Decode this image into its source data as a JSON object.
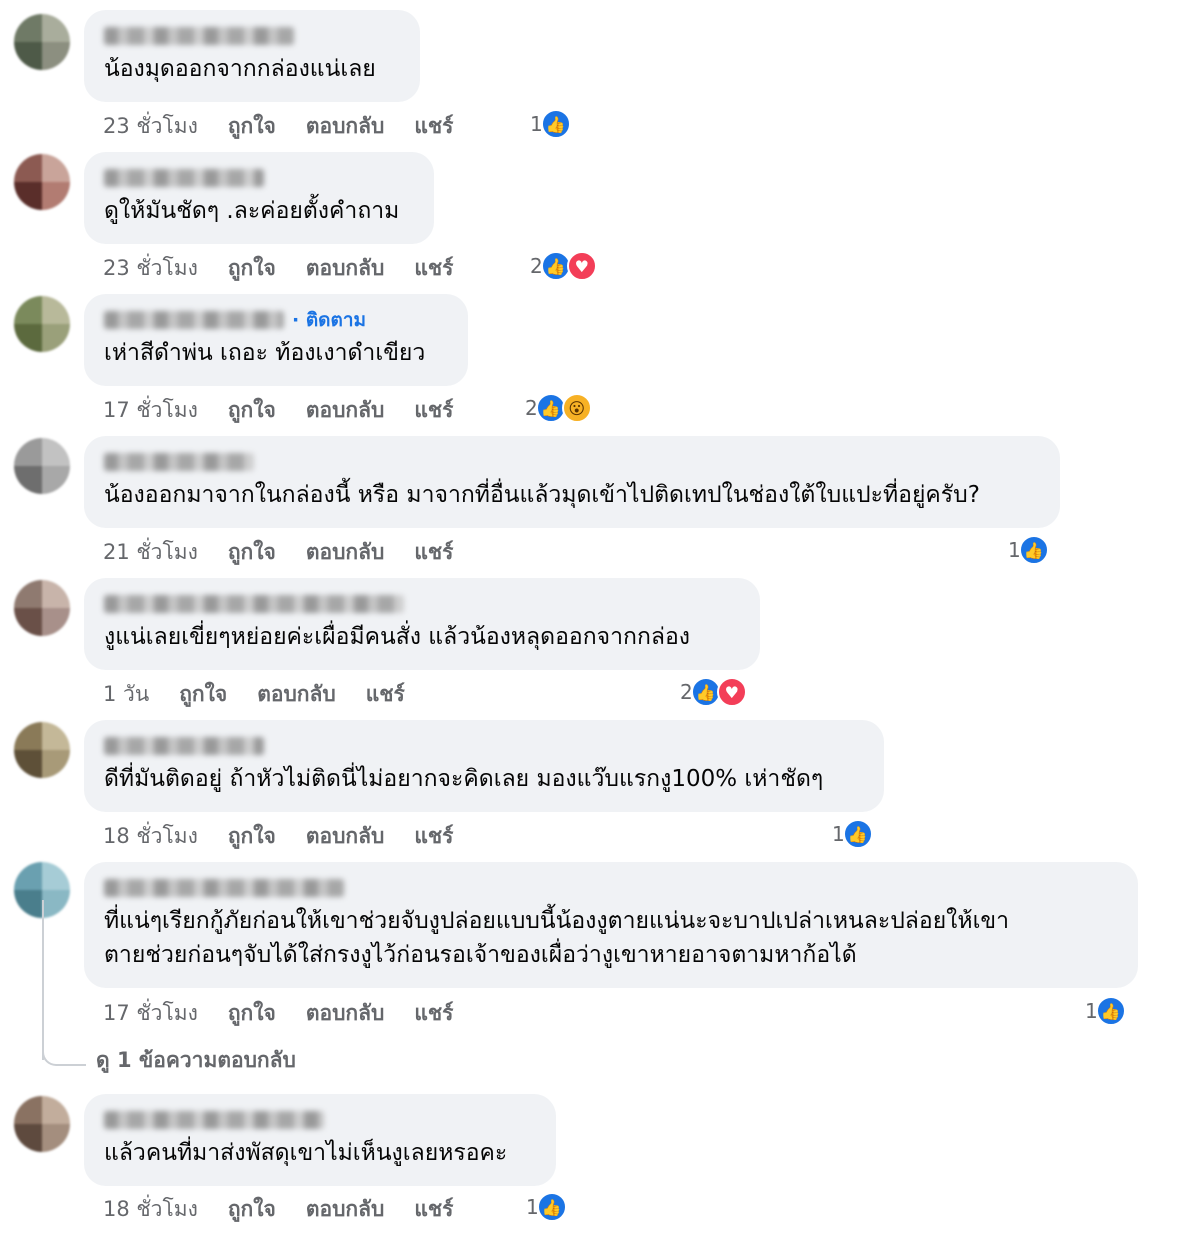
{
  "colors": {
    "like": "#1b74e4",
    "love": "#f33e58",
    "wow": "#f7b125",
    "bubble": "#f0f2f5",
    "meta": "#65676b"
  },
  "labels": {
    "like": "ถูกใจ",
    "reply": "ตอบกลับ",
    "share": "แชร์"
  },
  "comments": [
    {
      "text": "น้องมุดออกจากกล่องแน่เลย",
      "time": "23 ชั่วโมง",
      "reaction_count": "1",
      "reactions": [
        "like-icon"
      ]
    },
    {
      "text": "ดูให้มันชัดๆ .ละค่อยตั้งคำถาม",
      "time": "23 ชั่วโมง",
      "reaction_count": "2",
      "reactions": [
        "like-icon",
        "love-icon"
      ]
    },
    {
      "text": "เห่าสีดำพ่น เถอะ ท้องเงาดำเขียว",
      "follow": "· ติดตาม",
      "time": "17 ชั่วโมง",
      "reaction_count": "2",
      "reactions": [
        "like-icon",
        "wow-icon"
      ]
    },
    {
      "text": "น้องออกมาจากในกล่องนี้ หรือ มาจากที่อื่นแล้วมุดเข้าไปติดเทปในช่องใต้ใบแปะที่อยู่ครับ?",
      "time": "21 ชั่วโมง",
      "reaction_count": "1",
      "reactions": [
        "like-icon"
      ]
    },
    {
      "text": "งูแน่เลยเขี่ยๆหย่อยค่ะเผื่อมีคนสั่ง แล้วน้องหลุดออกจากกล่อง",
      "time": "1 วัน",
      "reaction_count": "2",
      "reactions": [
        "like-icon",
        "love-icon"
      ]
    },
    {
      "text": "ดีที่มันติดอยู่ ถ้าหัวไม่ติดนี่ไม่อยากจะคิดเลย มองแว๊บแรกงู100% เห่าชัดๆ",
      "time": "18 ชั่วโมง",
      "reaction_count": "1",
      "reactions": [
        "like-icon"
      ]
    },
    {
      "text_lines": [
        "ที่แน่ๆเรียกกู้ภัยก่อนให้เขาช่วยจับงูปล่อยแบบนี้น้องงูตายแน่นะจะบาปเปล่าเหนละปล่อยให้เขา",
        "ตายช่วยก่อนๆจับได้ใส่กรงงูไว้ก่อนรอเจ้าของเผื่อว่างูเขาหายอาจตามหาก้อได้"
      ],
      "time": "17 ชั่วโมง",
      "reaction_count": "1",
      "reactions": [
        "like-icon"
      ],
      "view_replies": "ดู 1 ข้อความตอบกลับ"
    },
    {
      "text": "แล้วคนที่มาส่งพัสดุเขาไม่เห็นงูเลยหรอคะ",
      "time": "18 ชั่วโมง",
      "reaction_count": "1",
      "reactions": [
        "like-icon"
      ]
    }
  ]
}
